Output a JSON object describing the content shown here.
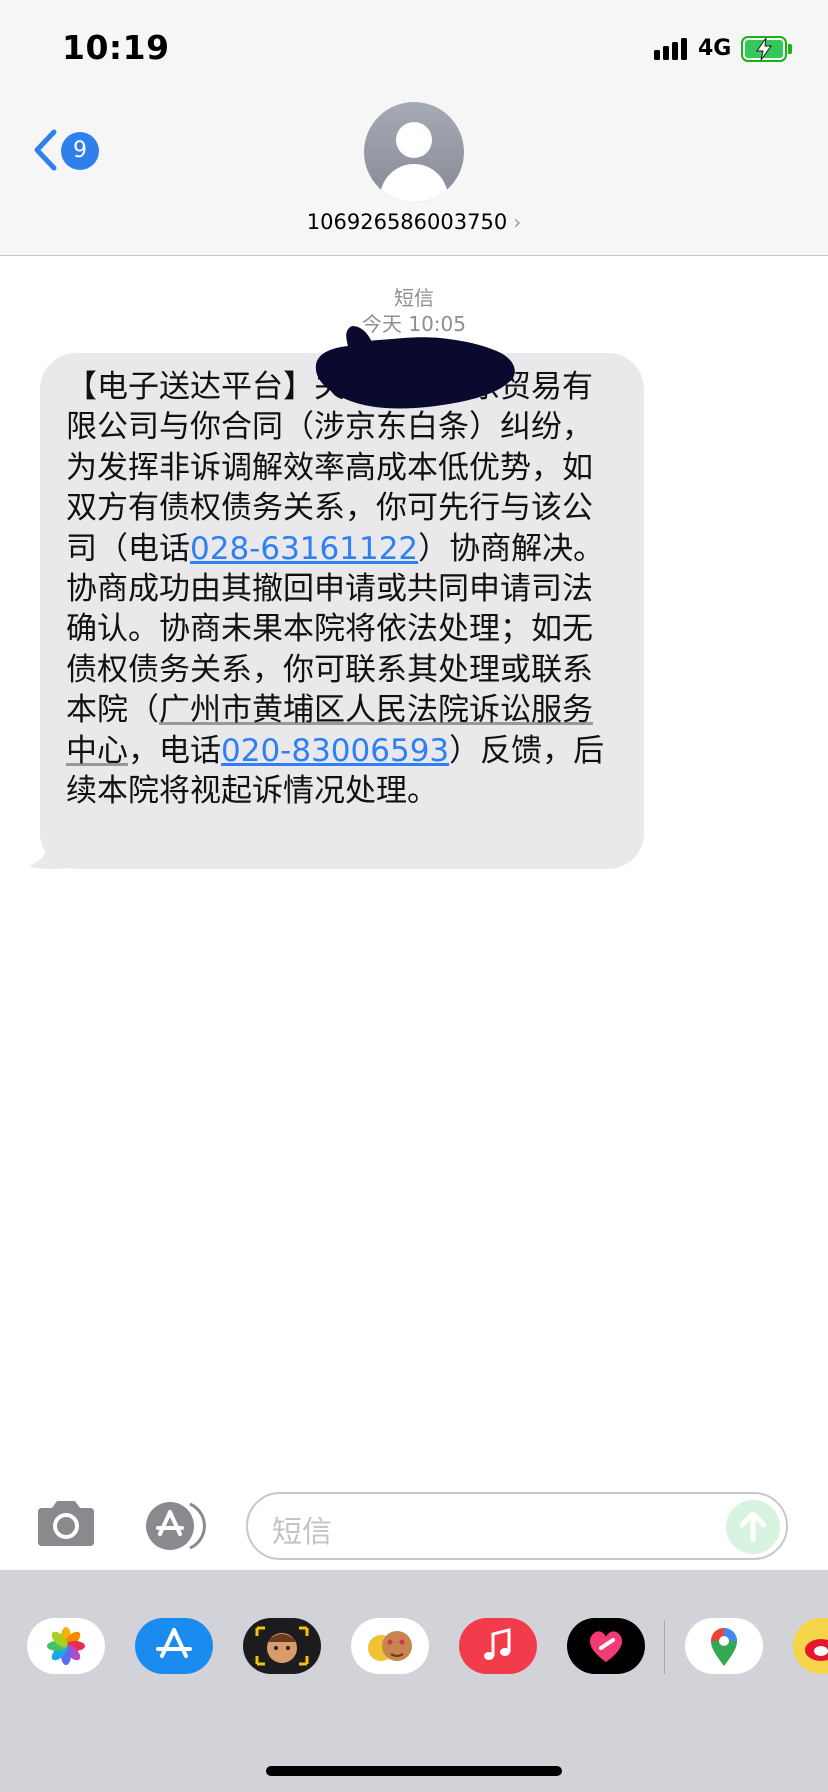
{
  "status_bar": {
    "time": "10:19",
    "network": "4G",
    "battery_charging": true,
    "signal_icon": "cellular-signal-icon",
    "battery_icon": "battery-charging-icon"
  },
  "nav": {
    "back_icon": "chevron-left-icon",
    "unread_count": "9"
  },
  "contact": {
    "avatar_icon": "person-avatar-icon",
    "number": "106926586003750",
    "chevron": "›"
  },
  "thread": {
    "service_label": "短信",
    "timestamp": "今天 10:05"
  },
  "message": {
    "part1": "【电子送达平台】",
    "part2": "关于广州晶东贸易有限公司与你合同（涉京东白条）纠纷，为发挥非诉调解效率高成本低优势，如双方有债权债务关系，你可先行与该公司（电话",
    "phone1": "028-63161122",
    "part3": "）协商解决。协商成功由其撤回申请或共同申请司法确认。协商未果本院将依法处理；如无债权债务关系，你可联系其处理或联系本院（",
    "address": "广州市黄埔区人民法院诉讼服务中心",
    "part4": "，电话",
    "phone2": "020-83006593",
    "part5": "）反馈，后续本院将视起诉情况处理。"
  },
  "composer": {
    "placeholder": "短信",
    "camera_icon": "camera-icon",
    "apps_icon": "app-store-icon",
    "send_icon": "send-arrow-icon"
  },
  "app_drawer": {
    "apps": [
      "photos-icon",
      "app-store-icon",
      "memoji-icon",
      "animoji-stickers-icon",
      "music-icon",
      "digital-touch-icon",
      "maps-icon",
      "weibo-icon"
    ]
  },
  "colors": {
    "accent": "#2f80ed",
    "link": "#2f7ff5",
    "bubble_received": "#e9e9eb",
    "battery_green": "#34c759"
  }
}
